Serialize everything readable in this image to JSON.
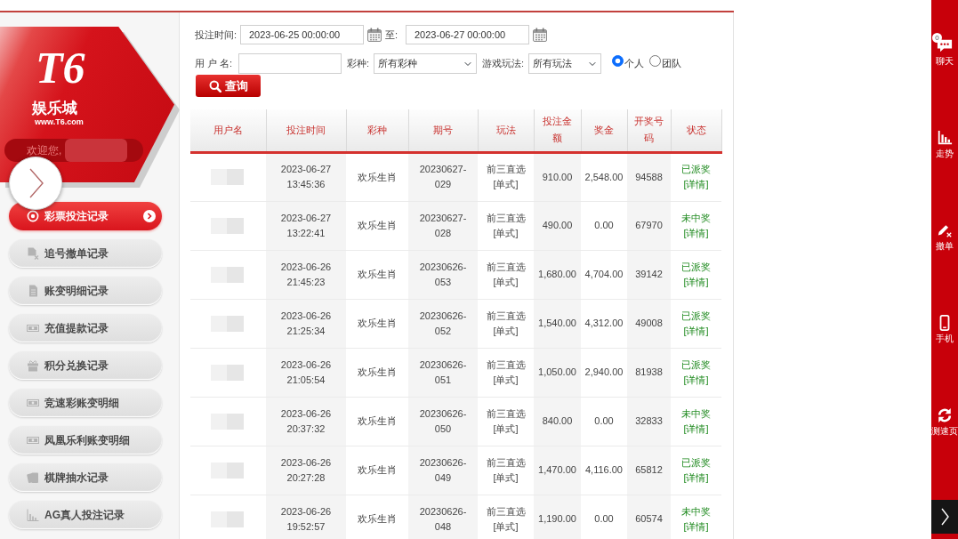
{
  "sidebar": {
    "logo": {
      "mark": "T6",
      "name": "娱乐城",
      "url": "www.T6.com"
    },
    "welcome": "欢迎您,",
    "menu": [
      {
        "kind": "lottery",
        "label": "彩票投注记录",
        "selected": true
      },
      {
        "kind": "chase",
        "label": "追号撤单记录",
        "selected": false
      },
      {
        "kind": "ledger",
        "label": "账变明细记录",
        "selected": false
      },
      {
        "kind": "cash",
        "label": "充值提款记录",
        "selected": false
      },
      {
        "kind": "gift",
        "label": "积分兑换记录",
        "selected": false
      },
      {
        "kind": "cash",
        "label": "竞速彩账变明细",
        "selected": false
      },
      {
        "kind": "cash",
        "label": "凤凰乐利账变明细",
        "selected": false
      },
      {
        "kind": "cards",
        "label": "棋牌抽水记录",
        "selected": false
      },
      {
        "kind": "chart",
        "label": "AG真人投注记录",
        "selected": false
      }
    ]
  },
  "filters": {
    "bet_time": {
      "label": "投注时间:",
      "from": "2023-06-25 00:00:00",
      "to_label": "至:",
      "to": "2023-06-27 00:00:00"
    },
    "username": {
      "label": "用 户 名:"
    },
    "lottery": {
      "label": "彩种:",
      "value": "所有彩种"
    },
    "play": {
      "label": "游戏玩法:",
      "value": "所有玩法"
    },
    "scope": [
      {
        "label": "个人",
        "selected": true
      },
      {
        "label": "团队",
        "selected": false
      }
    ],
    "search_button": "查询"
  },
  "table": {
    "columns": [
      "用户名",
      "投注时间",
      "彩种",
      "期号",
      "玩法",
      "投注金额",
      "奖金",
      "开奖号码",
      "状态"
    ],
    "rows": [
      {
        "bet_time": "2023-06-27 13:45:36",
        "lottery": "欢乐生肖",
        "period": "20230627-029",
        "play": "前三直选[单式]",
        "bet_amount": "910.00",
        "prize": "2,548.00",
        "draw_number": "94588",
        "status": "已派奖",
        "detail": "[详情]"
      },
      {
        "bet_time": "2023-06-27 13:22:41",
        "lottery": "欢乐生肖",
        "period": "20230627-028",
        "play": "前三直选[单式]",
        "bet_amount": "490.00",
        "prize": "0.00",
        "draw_number": "67970",
        "status": "未中奖",
        "detail": "[详情]"
      },
      {
        "bet_time": "2023-06-26 21:45:23",
        "lottery": "欢乐生肖",
        "period": "20230626-053",
        "play": "前三直选[单式]",
        "bet_amount": "1,680.00",
        "prize": "4,704.00",
        "draw_number": "39142",
        "status": "已派奖",
        "detail": "[详情]"
      },
      {
        "bet_time": "2023-06-26 21:25:34",
        "lottery": "欢乐生肖",
        "period": "20230626-052",
        "play": "前三直选[单式]",
        "bet_amount": "1,540.00",
        "prize": "4,312.00",
        "draw_number": "49008",
        "status": "已派奖",
        "detail": "[详情]"
      },
      {
        "bet_time": "2023-06-26 21:05:54",
        "lottery": "欢乐生肖",
        "period": "20230626-051",
        "play": "前三直选[单式]",
        "bet_amount": "1,050.00",
        "prize": "2,940.00",
        "draw_number": "81938",
        "status": "已派奖",
        "detail": "[详情]"
      },
      {
        "bet_time": "2023-06-26 20:37:32",
        "lottery": "欢乐生肖",
        "period": "20230626-050",
        "play": "前三直选[单式]",
        "bet_amount": "840.00",
        "prize": "0.00",
        "draw_number": "32833",
        "status": "未中奖",
        "detail": "[详情]"
      },
      {
        "bet_time": "2023-06-26 20:27:28",
        "lottery": "欢乐生肖",
        "period": "20230626-049",
        "play": "前三直选[单式]",
        "bet_amount": "1,470.00",
        "prize": "4,116.00",
        "draw_number": "65812",
        "status": "已派奖",
        "detail": "[详情]"
      },
      {
        "bet_time": "2023-06-26 19:52:57",
        "lottery": "欢乐生肖",
        "period": "20230626-048",
        "play": "前三直选[单式]",
        "bet_amount": "1,190.00",
        "prize": "0.00",
        "draw_number": "60574",
        "status": "未中奖",
        "detail": "[详情]"
      }
    ]
  },
  "right_bar": {
    "items": [
      {
        "kind": "chat",
        "label": "聊天",
        "badge": "0"
      },
      {
        "kind": "trend",
        "label": "走势"
      },
      {
        "kind": "cancel",
        "label": "撤单"
      },
      {
        "kind": "phone",
        "label": "手机"
      },
      {
        "kind": "refresh",
        "label": "测速页"
      }
    ]
  }
}
